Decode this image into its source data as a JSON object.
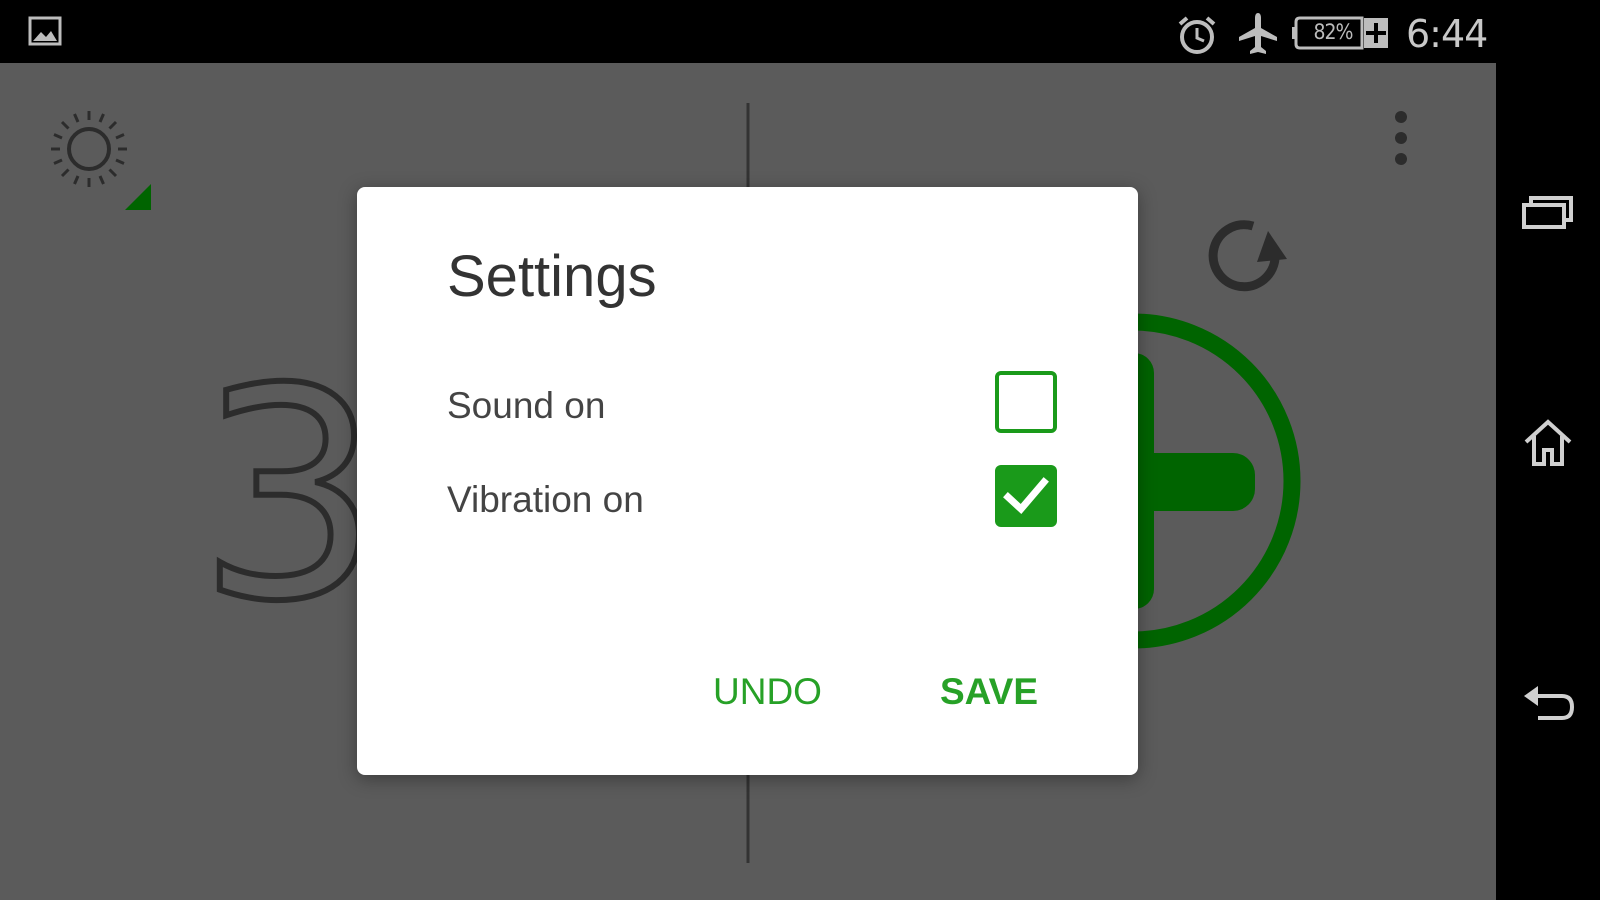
{
  "status_bar": {
    "icons": [
      "gallery-icon",
      "alarm-icon",
      "airplane-mode-icon",
      "battery-charging-icon"
    ],
    "battery_percent": "82%",
    "time": "6:44"
  },
  "nav_bar": {
    "icons": [
      "recent-apps-icon",
      "home-icon",
      "back-icon"
    ]
  },
  "app": {
    "icons": [
      "brightness-icon",
      "more-options-icon",
      "refresh-icon",
      "add-circle-icon"
    ],
    "counter_value": "3",
    "accent_color": "#006400"
  },
  "dialog": {
    "title": "Settings",
    "settings": [
      {
        "label": "Sound on",
        "checked": false
      },
      {
        "label": "Vibration on",
        "checked": true
      }
    ],
    "undo_label": "UNDO",
    "save_label": "SAVE",
    "accent_color": "#1a9a1a"
  }
}
